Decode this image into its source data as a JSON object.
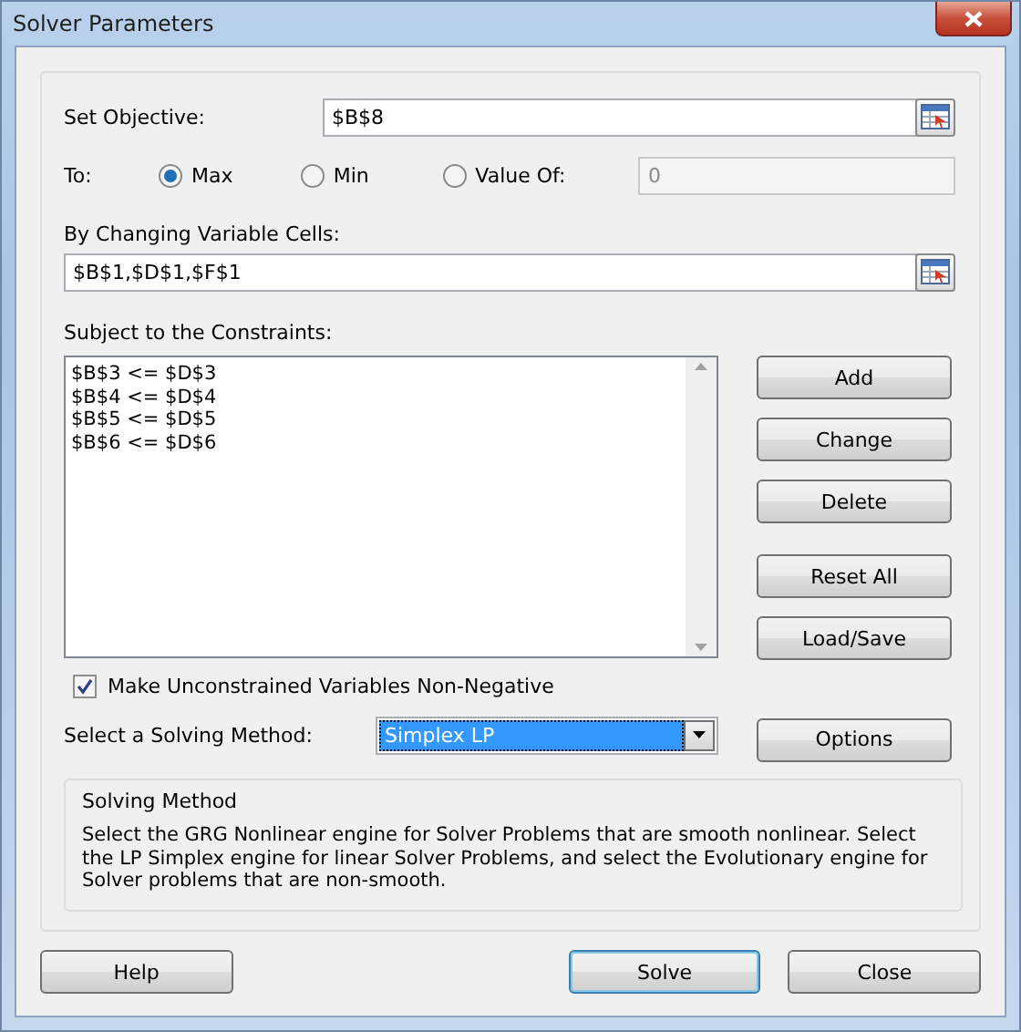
{
  "window": {
    "title": "Solver Parameters"
  },
  "objective": {
    "label": "Set Objective:",
    "value": "$B$8"
  },
  "to": {
    "label": "To:",
    "options": [
      {
        "label": "Max",
        "selected": true
      },
      {
        "label": "Min",
        "selected": false
      },
      {
        "label": "Value Of:",
        "selected": false
      }
    ],
    "value_of": {
      "value": "0",
      "disabled": true
    }
  },
  "changing_cells": {
    "label": "By Changing Variable Cells:",
    "value": "$B$1,$D$1,$F$1"
  },
  "constraints": {
    "label": "Subject to the Constraints:",
    "items": [
      "$B$3 <= $D$3",
      "$B$4 <= $D$4",
      "$B$5 <= $D$5",
      "$B$6 <= $D$6"
    ]
  },
  "side_buttons": [
    {
      "label": "Add",
      "gap": false
    },
    {
      "label": "Change",
      "gap": false
    },
    {
      "label": "Delete",
      "gap": false
    },
    {
      "label": "Reset All",
      "gap": true
    },
    {
      "label": "Load/Save",
      "gap": false
    }
  ],
  "non_negative": {
    "label": "Make Unconstrained Variables Non-Negative",
    "checked": true
  },
  "method": {
    "label": "Select a Solving Method:",
    "value": "Simplex LP",
    "options_button": "Options"
  },
  "description": {
    "title": "Solving Method",
    "text": "Select the GRG Nonlinear engine for Solver Problems that are smooth nonlinear. Select the LP Simplex engine for linear Solver Problems, and select the Evolutionary engine for Solver problems that are non-smooth."
  },
  "footer_buttons": [
    {
      "label": "Help",
      "default": false
    },
    {
      "label": "Solve",
      "default": true
    },
    {
      "label": "Close",
      "default": false
    }
  ]
}
